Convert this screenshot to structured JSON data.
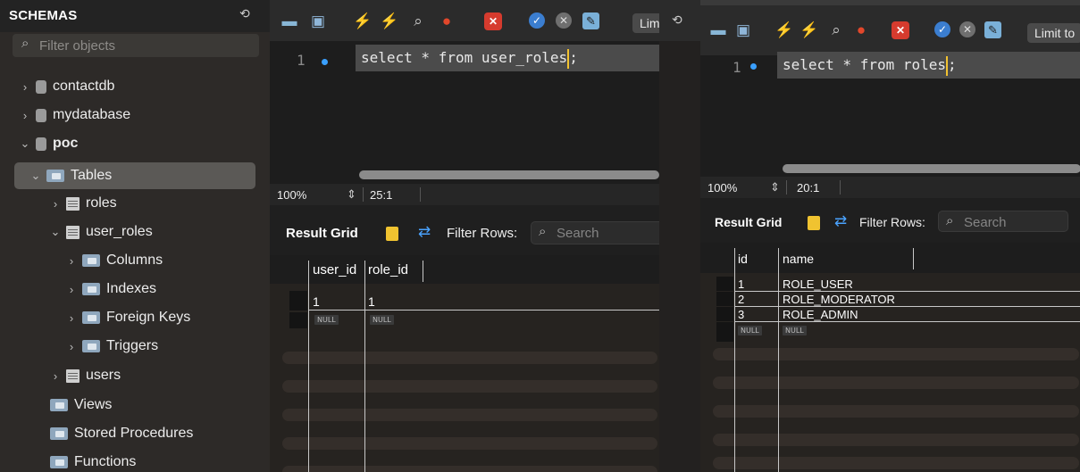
{
  "sidebar": {
    "title": "SCHEMAS",
    "filter_placeholder": "Filter objects",
    "items": [
      {
        "label": "contactdb"
      },
      {
        "label": "mydatabase"
      },
      {
        "label": "poc"
      },
      {
        "label": "Tables"
      },
      {
        "label": "roles"
      },
      {
        "label": "user_roles"
      },
      {
        "label": "Columns"
      },
      {
        "label": "Indexes"
      },
      {
        "label": "Foreign Keys"
      },
      {
        "label": "Triggers"
      },
      {
        "label": "users"
      },
      {
        "label": "Views"
      },
      {
        "label": "Stored Procedures"
      },
      {
        "label": "Functions"
      }
    ]
  },
  "left_panel": {
    "limit_label": "Lim",
    "line_number": "1",
    "query": "select * from user_roles",
    "query_suffix": ";",
    "zoom": "100%",
    "cursor_pos": "25:1",
    "result_grid_label": "Result Grid",
    "filter_rows_label": "Filter Rows:",
    "search_placeholder": "Search",
    "columns": [
      "user_id",
      "role_id"
    ],
    "rows": [
      [
        "1",
        "1"
      ]
    ],
    "null_label": "NULL"
  },
  "right_panel": {
    "limit_label": "Limit to",
    "line_number": "1",
    "query": "select * from roles",
    "query_suffix": ";",
    "zoom": "100%",
    "cursor_pos": "20:1",
    "result_grid_label": "Result Grid",
    "filter_rows_label": "Filter Rows:",
    "search_placeholder": "Search",
    "columns": [
      "id",
      "name"
    ],
    "rows": [
      [
        "1",
        "ROLE_USER"
      ],
      [
        "2",
        "ROLE_MODERATOR"
      ],
      [
        "3",
        "ROLE_ADMIN"
      ]
    ],
    "null_label": "NULL"
  },
  "icons": {
    "search": "search-icon",
    "refresh": "refresh-icon",
    "database": "database-icon",
    "folder": "folder-icon",
    "table": "table-icon"
  },
  "colors": {
    "accent_blue": "#3aa0ff",
    "bolt_yellow": "#f2c230",
    "stop_red": "#e2472b"
  }
}
